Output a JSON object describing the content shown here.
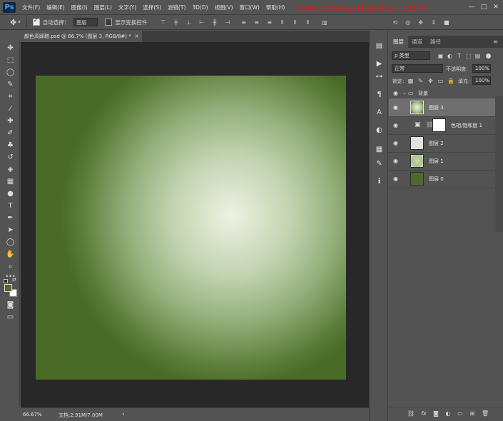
{
  "app": {
    "logo": "Ps"
  },
  "menu": [
    "文件(F)",
    "编辑(E)",
    "图像(I)",
    "图层(L)",
    "文字(Y)",
    "选择(S)",
    "滤镜(T)",
    "3D(D)",
    "视图(V)",
    "窗口(W)",
    "帮助(H)"
  ],
  "watermark": "www.baeyidianhei.com",
  "window_controls": [
    "—",
    "□",
    "✕"
  ],
  "options": {
    "auto_select_label": "自动选择：",
    "auto_select_value": "图层",
    "show_transform_label": "显示变换控件"
  },
  "document": {
    "tab_title": "颜色高踩鞋.psd @ 66.7% (图层 3, RGB/8#) *",
    "close": "×"
  },
  "status": {
    "zoom": "66.67%",
    "doc_info": "文档:2.91M/7.00M",
    "arrow": "›"
  },
  "layers_panel": {
    "tabs": [
      "图层",
      "通道",
      "路径"
    ],
    "filter_kind": "ρ 类型",
    "blend_mode": "正常",
    "opacity_label": "不透明度:",
    "opacity_value": "100%",
    "lock_label": "锁定:",
    "fill_label": "填充:",
    "fill_value": "100%",
    "group_name": "背景",
    "layers": [
      {
        "name": "图层 3",
        "selected": true
      },
      {
        "name": "色相/饱和度 1",
        "selected": false
      },
      {
        "name": "图层 2",
        "selected": false
      },
      {
        "name": "图层 1",
        "selected": false
      },
      {
        "name": "图层 0",
        "selected": false
      }
    ]
  },
  "colors": {
    "foreground": "#4d6a2c",
    "background": "#ffffff",
    "canvas_edge": "#4a6a28",
    "canvas_center": "#eef2e4"
  }
}
